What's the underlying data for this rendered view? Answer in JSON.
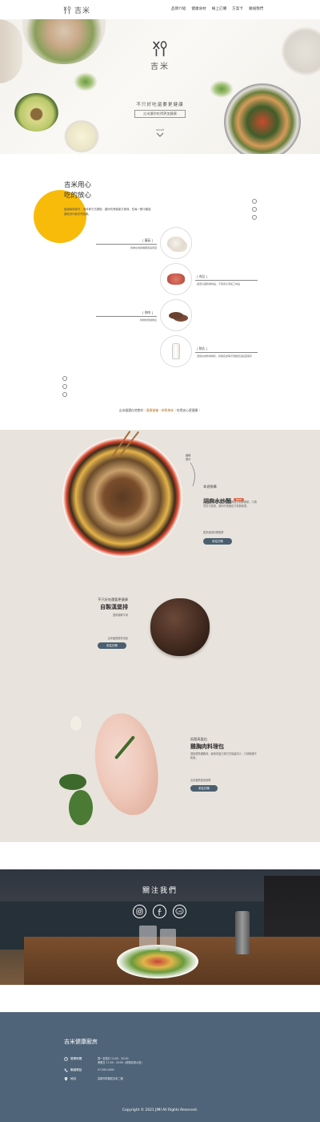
{
  "header": {
    "brand": "吉米",
    "nav": [
      "品牌介紹",
      "健康食材",
      "線上訂購",
      "方案卡",
      "聯絡我們"
    ]
  },
  "hero": {
    "brand": "吉米",
    "title": "不只好吃還要更健康",
    "subtitle": "吉米讓你吃得更加健康",
    "scroll_label": "scroll"
  },
  "care": {
    "title_line1": "吉米用心",
    "title_line2": "吃的放心",
    "description": "嚴選每樣食材，用科學方式調配，讓你吃得健康又美味，在每一餐中都能攝取到均衡的營養素。",
    "ingredients": [
      {
        "name": "[ 蘑菇 ]",
        "desc": "新鮮在地栽種蘑菇與香菇"
      },
      {
        "name": "[ 肉品 ]",
        "desc": "嚴選冷藏新鮮肉品，不使用冷凍加工肉品"
      },
      {
        "name": "[ 咖啡 ]",
        "desc": "新鮮烘焙咖啡豆"
      },
      {
        "name": "[ 鮮乳 ]",
        "desc": "選用在地牧場鮮乳，新鮮直送每天現做低溫殺菌保存"
      }
    ],
    "footer_prefix": "吉米嚴選在地食材｜",
    "footer_highlight1": "健康營養",
    "footer_sep": "｜",
    "footer_highlight2": "新鮮美味",
    "footer_suffix": "｜吃得安心更健康｜"
  },
  "products": [
    {
      "tag": "本週推薦",
      "name": "胡麻水炒麵",
      "badge": "NEW",
      "desc": "清爽的胡麻醬搭配蕎麥麵與各式新鮮蔬菜，口感豐富又健康，讓你吃得飽足又毫無負擔。",
      "link_text": "更多健康料理推薦",
      "button": "前往訂購"
    },
    {
      "tag": "不只好吃還要更健康",
      "name": "自製漢堡排",
      "desc": "選用新鮮牛肉",
      "link_text": "吉米嚴選優質肉品",
      "button": "前往訂購"
    },
    {
      "tag": "低脂高蛋白",
      "name": "雞胸肉料理包",
      "desc": "選用優質雞胸肉，使用低溫烹調方式保留肉汁，口感軟嫩不乾柴。",
      "link_text": "吉米推薦健身族群",
      "button": "前往訂購"
    }
  ],
  "side_note": "麵條\n彈牙",
  "follow": {
    "title": "關注我們"
  },
  "footer": {
    "title": "吉米健康廚房",
    "hours_label": "營業時間",
    "hours_value": "週一至週日 11:00 - 20:00\n例假日 11:00 - 20:00（依照店家公告）",
    "phone_label": "聯絡電話",
    "phone_value": "07-000-0000",
    "address_label": "地址",
    "address_value": "高雄市前鎮區吉米二路",
    "copyright": "Copyright © 2021 JIMI All Rights Reserved."
  },
  "colors": {
    "accent_yellow": "#f8bb0a",
    "footer_bg": "#4f6478",
    "button": "#4a5f70",
    "products_bg": "#e8e3dc"
  }
}
